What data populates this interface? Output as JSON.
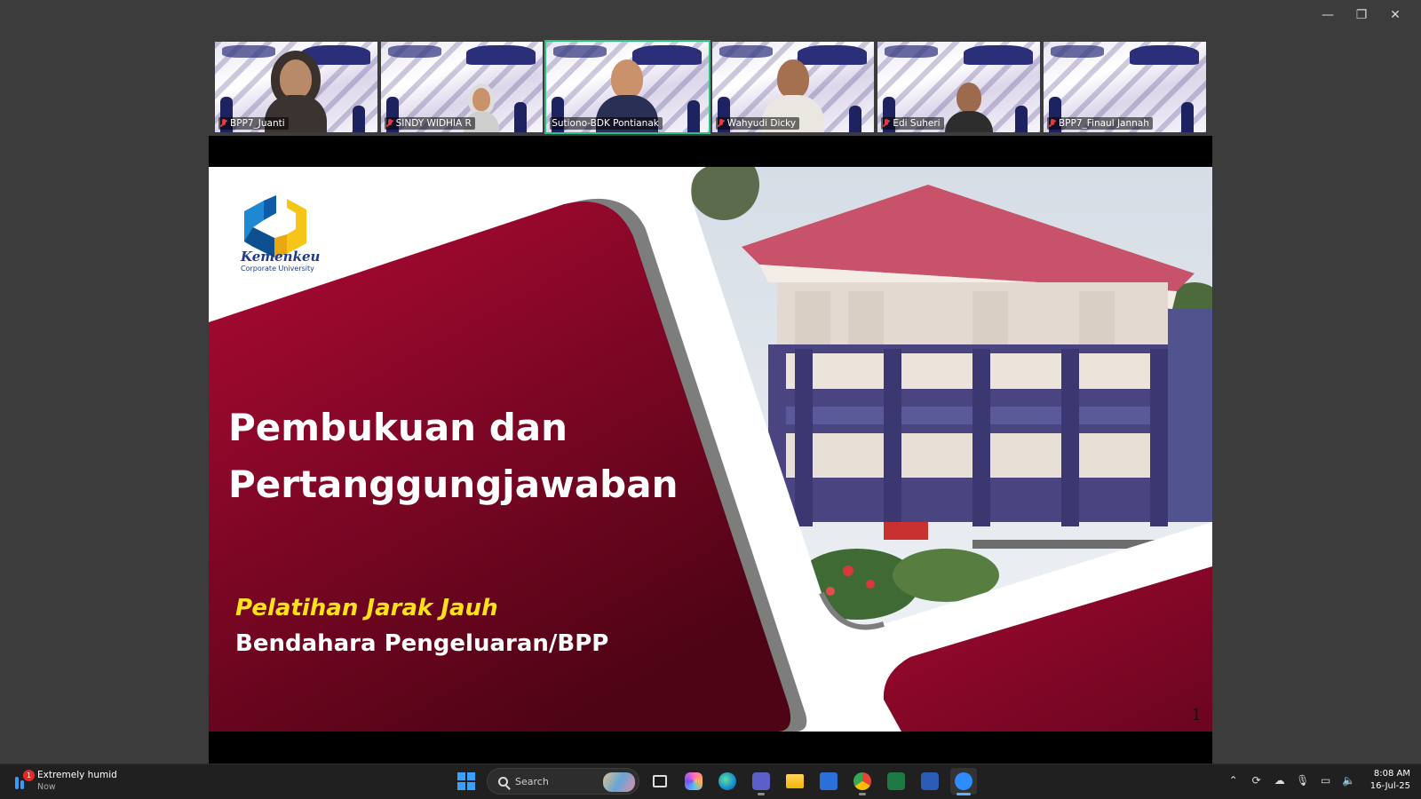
{
  "window": {
    "controls": [
      "—",
      "❐",
      "✕"
    ]
  },
  "participants": [
    {
      "name": "BPP7_Juanti",
      "muted": true,
      "active": false
    },
    {
      "name": "SINDY WIDHIA R",
      "muted": true,
      "active": false
    },
    {
      "name": "Sutiono-BDK Pontianak",
      "muted": false,
      "active": true
    },
    {
      "name": "Wahyudi Dicky",
      "muted": true,
      "active": false
    },
    {
      "name": "Edi Suheri",
      "muted": true,
      "active": false
    },
    {
      "name": "BPP7_Finaul Jannah",
      "muted": true,
      "active": false
    }
  ],
  "slide": {
    "logo_text": "Kemenkeu",
    "logo_subtext": "Corporate University",
    "title_line1": "Pembukuan dan",
    "title_line2": "Pertanggungjawaban",
    "subtitle1": "Pelatihan Jarak Jauh",
    "subtitle2": "Bendahara Pengeluaran/BPP",
    "page_number": "1",
    "colors": {
      "maroon_light": "#b00a34",
      "maroon_dark": "#4e0415",
      "accent_yellow": "#ffe21a"
    }
  },
  "taskbar": {
    "weather": {
      "text": "Extremely humid",
      "sub": "Now",
      "badge": "1"
    },
    "search_placeholder": "Search",
    "apps": [
      "windows-start",
      "task-view",
      "copilot",
      "edge",
      "teams",
      "file-explorer",
      "microsoft-store",
      "chrome",
      "excel",
      "word",
      "zoom"
    ],
    "clock": {
      "time": "8:08 AM",
      "date": "16-Jul-25"
    }
  }
}
